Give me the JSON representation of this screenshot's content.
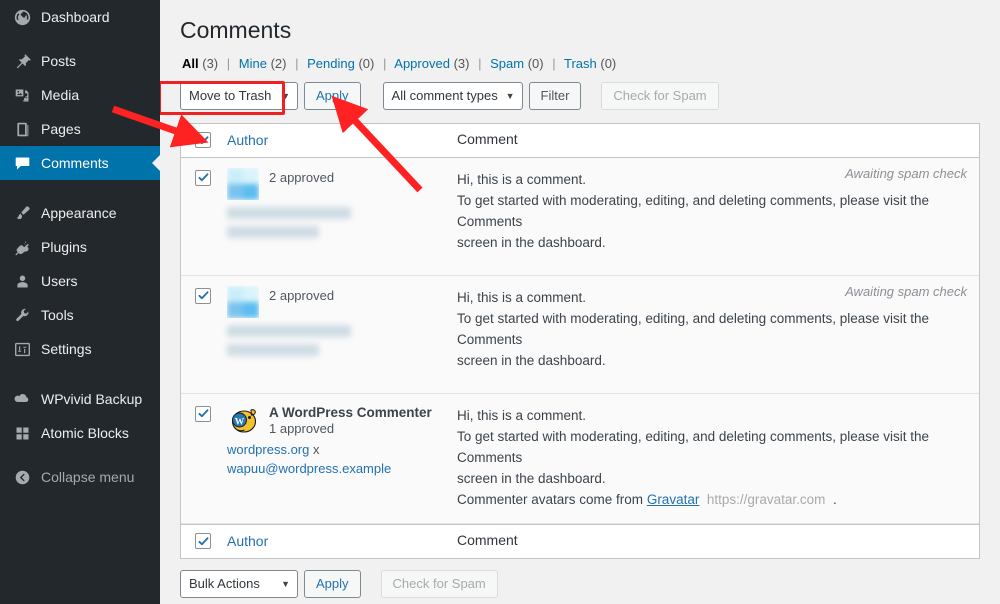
{
  "sidebar": {
    "items": [
      {
        "label": "Dashboard",
        "icon": "dashboard-icon",
        "current": false
      },
      {
        "label": "Posts",
        "icon": "pin-icon",
        "current": false
      },
      {
        "label": "Media",
        "icon": "media-icon",
        "current": false
      },
      {
        "label": "Pages",
        "icon": "pages-icon",
        "current": false
      },
      {
        "label": "Comments",
        "icon": "comment-bubble-icon",
        "current": true
      },
      {
        "label": "Appearance",
        "icon": "brush-icon",
        "current": false
      },
      {
        "label": "Plugins",
        "icon": "plug-icon",
        "current": false
      },
      {
        "label": "Users",
        "icon": "user-icon",
        "current": false
      },
      {
        "label": "Tools",
        "icon": "wrench-icon",
        "current": false
      },
      {
        "label": "Settings",
        "icon": "sliders-icon",
        "current": false
      },
      {
        "label": "WPvivid Backup",
        "icon": "cloud-icon",
        "current": false
      },
      {
        "label": "Atomic Blocks",
        "icon": "blocks-icon",
        "current": false
      },
      {
        "label": "Collapse menu",
        "icon": "collapse-arrow-icon",
        "current": false
      }
    ]
  },
  "page": {
    "title": "Comments"
  },
  "filters": [
    {
      "label": "All",
      "count": "(3)",
      "current": true
    },
    {
      "label": "Mine",
      "count": "(2)",
      "current": false
    },
    {
      "label": "Pending",
      "count": "(0)",
      "current": false
    },
    {
      "label": "Approved",
      "count": "(3)",
      "current": false
    },
    {
      "label": "Spam",
      "count": "(0)",
      "current": false
    },
    {
      "label": "Trash",
      "count": "(0)",
      "current": false
    }
  ],
  "toolbar_top": {
    "bulk_action_value": "Move to Trash",
    "apply_label": "Apply",
    "comment_type_value": "All comment types",
    "filter_label": "Filter",
    "check_spam_label": "Check for Spam",
    "highlight_color": "#ee2222"
  },
  "toolbar_bottom": {
    "bulk_action_value": "Bulk Actions",
    "apply_label": "Apply",
    "check_spam_label": "Check for Spam"
  },
  "table": {
    "columns": {
      "author": "Author",
      "comment": "Comment"
    },
    "rows": [
      {
        "checked": true,
        "author_redacted": true,
        "author_name": "",
        "approved": "2 approved",
        "site": "",
        "email": "",
        "comment_line1": "Hi, this is a comment.",
        "comment_line2": "To get started with moderating, editing, and deleting comments, please visit the Comments",
        "comment_line3": "screen in the dashboard.",
        "comment_line4": "",
        "status_note": "Awaiting spam check"
      },
      {
        "checked": true,
        "author_redacted": true,
        "author_name": "",
        "approved": "2 approved",
        "site": "",
        "email": "",
        "comment_line1": "Hi, this is a comment.",
        "comment_line2": "To get started with moderating, editing, and deleting comments, please visit the Comments",
        "comment_line3": "screen in the dashboard.",
        "comment_line4": "",
        "status_note": "Awaiting spam check"
      },
      {
        "checked": true,
        "author_redacted": false,
        "author_name": "A WordPress Commenter",
        "approved": "1 approved",
        "site": "wordpress.org",
        "site_remove": "x",
        "email": "wapuu@wordpress.example",
        "comment_line1": "Hi, this is a comment.",
        "comment_line2": "To get started with moderating, editing, and deleting comments, please visit the Comments",
        "comment_line3": "screen in the dashboard.",
        "comment_line4_prefix": "Commenter avatars come from ",
        "comment_line4_link": "Gravatar",
        "comment_line4_url": "https://gravatar.com",
        "comment_line4_suffix": ".",
        "status_note": ""
      }
    ]
  },
  "colors": {
    "sidebar_bg": "#23282d",
    "current_menu": "#0073aa",
    "link": "#2271b1",
    "annotation_red": "#ee2222"
  }
}
